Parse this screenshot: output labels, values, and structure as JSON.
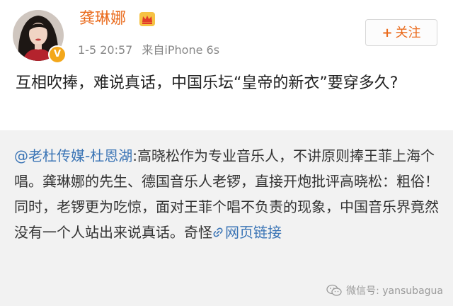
{
  "post": {
    "username": "龚琳娜",
    "time": "1-5 20:57",
    "source": "来自iPhone 6s",
    "follow_label": "关注",
    "follow_plus": "+",
    "verified_badge": "V",
    "text": "互相吹捧，难说真话，中国乐坛“皇帝的新衣”要穿多久?"
  },
  "repost": {
    "mention": "@老杜传媒-杜恩湖",
    "body": ":高晓松作为专业音乐人，不讲原则捧王菲上海个唱。龚琳娜的先生、德国音乐人老锣，直接开炮批评高晓松：粗俗！同时，老锣更为吃惊，面对王菲个唱不负责的现象，中国音乐界竟然没有一个人站出来说真话。奇怪",
    "link_label": "网页链接"
  },
  "watermark": {
    "text": "微信号: yansubagua"
  },
  "icons": {
    "crown": "crown-icon",
    "link": "link-icon",
    "wechat": "wechat-icon"
  },
  "colors": {
    "username": "#ea6b1d",
    "link": "#3a74b5",
    "repost_bg": "#f2f2f2",
    "badge": "#f3a71b"
  }
}
